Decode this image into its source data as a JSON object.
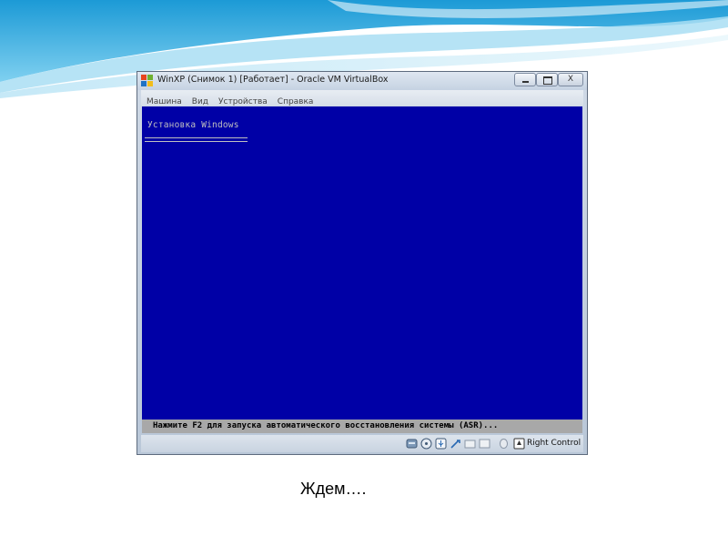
{
  "window": {
    "title": "WinXP (Снимок 1) [Работает] - Oracle VM VirtualBox",
    "icon": "virtualbox-app-icon",
    "controls": {
      "minimize_icon": "minimize-icon",
      "maximize_icon": "maximize-icon",
      "close_label": "X"
    }
  },
  "menubar": {
    "items": [
      {
        "label": "Машина"
      },
      {
        "label": "Вид"
      },
      {
        "label": "Устройства"
      },
      {
        "label": "Справка"
      }
    ]
  },
  "vm": {
    "screen_color": "#0000a6",
    "setup_title": "Установка Windows",
    "status_text": "Нажмите F2 для запуска автоматического восстановления системы (ASR)..."
  },
  "statusbar": {
    "icons": [
      "hard-disk-icon",
      "optical-drive-icon",
      "usb-icon",
      "network-icon",
      "shared-folders-icon",
      "capture-icon",
      "mouse-integration-icon",
      "host-key-icon"
    ],
    "host_key_label": "Right Control"
  },
  "caption": "Ждем…."
}
